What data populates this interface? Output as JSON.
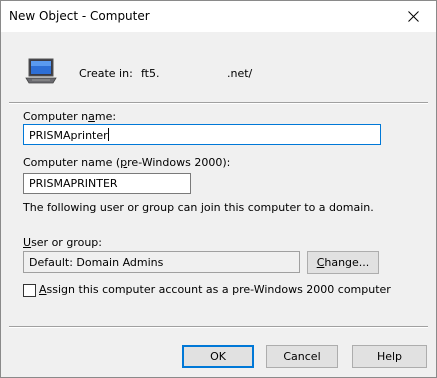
{
  "window": {
    "title": "New Object - Computer"
  },
  "header": {
    "create_in_label": "Create in:",
    "path_start": "ft5.",
    "path_end": ".net/"
  },
  "computer_name": {
    "label_pre": "Computer n",
    "label_access": "a",
    "label_post": "me:",
    "value": "PRISMAprinter"
  },
  "pre2000": {
    "label_pre": "Computer name (",
    "label_access": "p",
    "label_post": "re-Windows 2000):",
    "value": "PRISMAPRINTER"
  },
  "join_note": "The following user or group can join this computer to a domain.",
  "user_group": {
    "label_pre": "",
    "label_access": "U",
    "label_post": "ser or group:",
    "value": "Default: Domain Admins",
    "change_access": "C",
    "change_post": "hange..."
  },
  "assign_checkbox": {
    "label_pre": "",
    "label_access": "A",
    "label_post": "ssign this computer account as a pre-Windows 2000 computer",
    "checked": false
  },
  "buttons": {
    "ok": "OK",
    "cancel": "Cancel",
    "help": "Help"
  }
}
